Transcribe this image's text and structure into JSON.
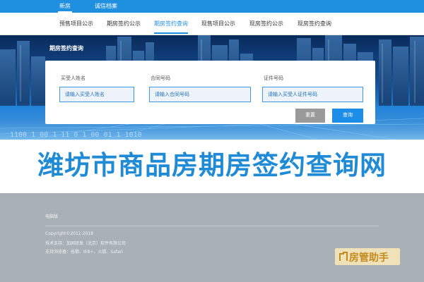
{
  "topbar": {
    "tabs": [
      {
        "label": "新房",
        "active": true
      },
      {
        "label": "诚信档案",
        "active": false
      }
    ]
  },
  "subnav": {
    "items": [
      {
        "label": "预售项目公示"
      },
      {
        "label": "期房签约公示"
      },
      {
        "label": "期房签约查询",
        "active": true
      },
      {
        "label": "现售项目公示"
      },
      {
        "label": "现房签约公示"
      },
      {
        "label": "现房签约查询"
      }
    ]
  },
  "hero": {
    "title": "期房签约查询",
    "digits": "1100 1 00 1 11 0 1 00 01 1 1010"
  },
  "search": {
    "buyer_name": {
      "label": "买受人姓名",
      "placeholder": "请输入买受人姓名"
    },
    "contract_no": {
      "label": "合同号码",
      "placeholder": "请输入合同号码"
    },
    "id_no": {
      "label": "证件号码",
      "placeholder": "请输入买受人证件号码"
    },
    "reset_label": "重置",
    "query_label": "查询"
  },
  "banner": {
    "text": "潍坊市商品房期房签约查询网"
  },
  "footer": {
    "link": "电脑版",
    "copyright": "Copyright©2011-2018",
    "tech_support": "技术支持：加固研发（北京）软件有限公司",
    "browsers": "支持浏览器：谷歌、IE8+、火狐、Safari"
  },
  "watermark": {
    "text": "房管助手",
    "icon": "house-icon"
  },
  "colors": {
    "primary": "#1f8fe0",
    "banner_text": "#1f8ad6",
    "footer_bg": "#a9b1b7",
    "reset_button": "#9a9a9a"
  }
}
